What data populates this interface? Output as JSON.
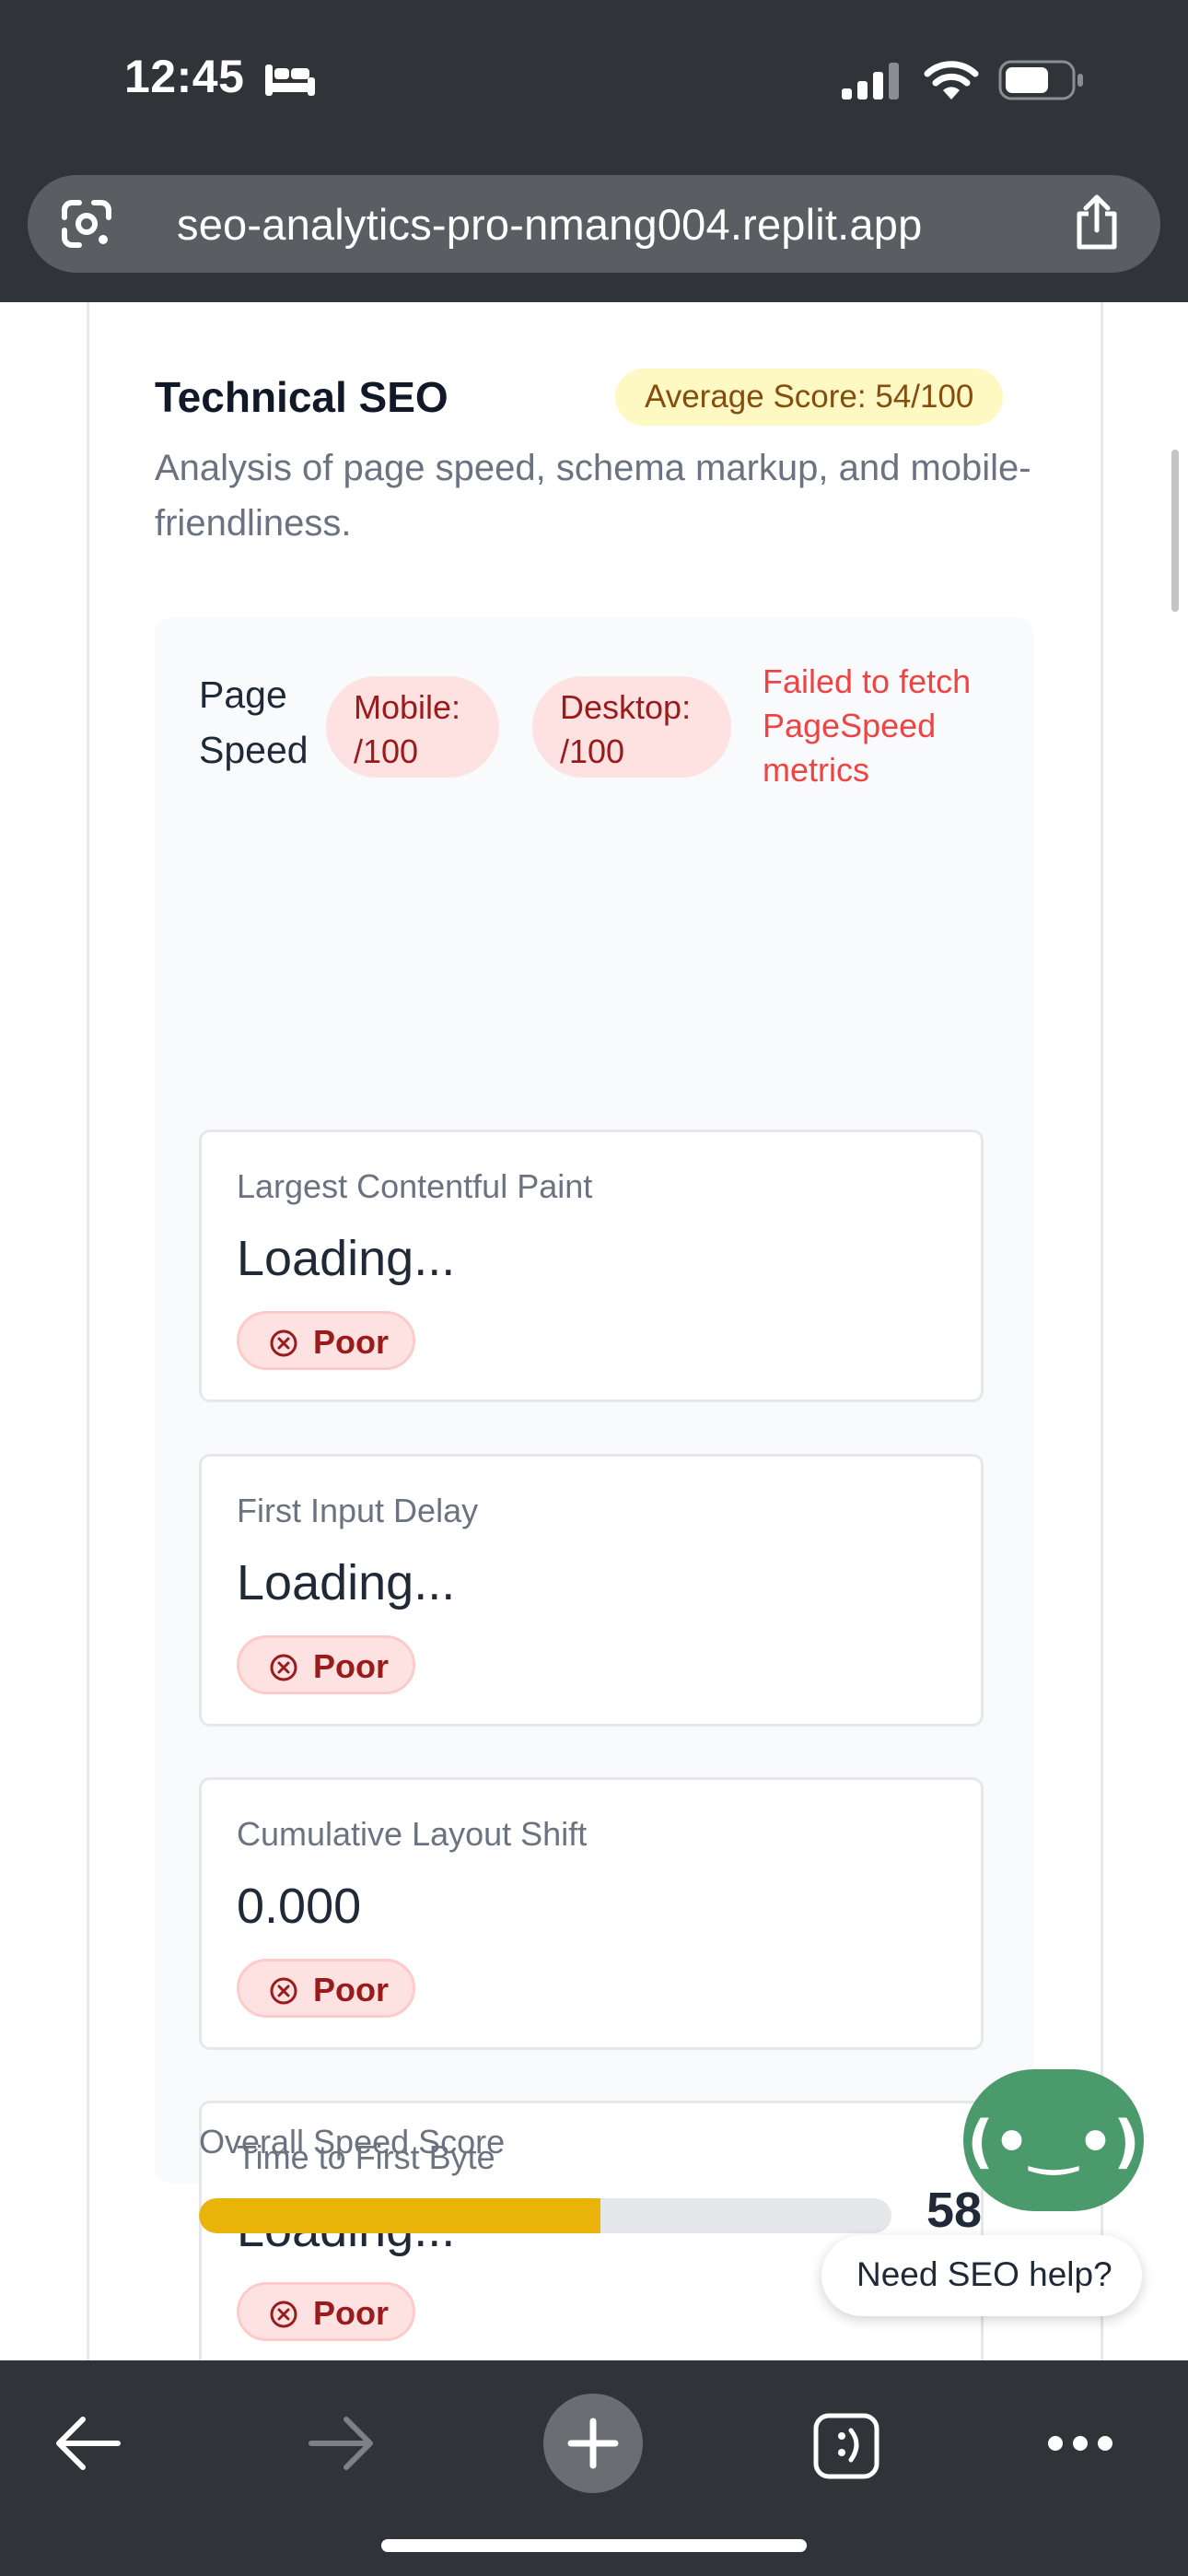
{
  "status_bar": {
    "time": "12:45",
    "icons": [
      "sleep-mode-icon",
      "cellular-signal-icon",
      "wifi-icon",
      "battery-icon"
    ]
  },
  "url_bar": {
    "url": "seo-analytics-pro-nmang004.replit.app",
    "icons": [
      "google-lens-icon",
      "share-icon"
    ]
  },
  "section": {
    "title": "Technical SEO",
    "average_badge": "Average Score: 54/100",
    "description": "Analysis of page speed, schema markup, and mobile-friendliness."
  },
  "page_speed": {
    "label": "Page Speed",
    "mobile_label": "Mobile:",
    "mobile_score": "/100",
    "desktop_label": "Desktop:",
    "desktop_score": "/100",
    "error": "Failed to fetch PageSpeed metrics",
    "metrics": [
      {
        "name": "Largest Contentful Paint",
        "value": "Loading...",
        "status": "Poor"
      },
      {
        "name": "First Input Delay",
        "value": "Loading...",
        "status": "Poor"
      },
      {
        "name": "Cumulative Layout Shift",
        "value": "0.000",
        "status": "Poor"
      },
      {
        "name": "Time to First Byte",
        "value": "Loading...",
        "status": "Poor"
      }
    ],
    "overall_label": "Overall Speed Score",
    "overall_value": "58",
    "overall_fraction": 0.58
  },
  "chat_widget": {
    "face": "(•‿•)",
    "help_text": "Need SEO help?"
  },
  "bottom_toolbar": {
    "icons": [
      "back-arrow-icon",
      "forward-arrow-icon",
      "new-tab-plus-icon",
      "tabs-icon",
      "more-dots-icon"
    ]
  },
  "colors": {
    "chrome_dark": "#303337",
    "badge_yellow_bg": "#fef9c3",
    "badge_yellow_text": "#854d0e",
    "poor_red": "#991b1b",
    "error_red": "#ef4444",
    "progress_yellow": "#eab308",
    "chat_green": "#4b9a6c"
  }
}
